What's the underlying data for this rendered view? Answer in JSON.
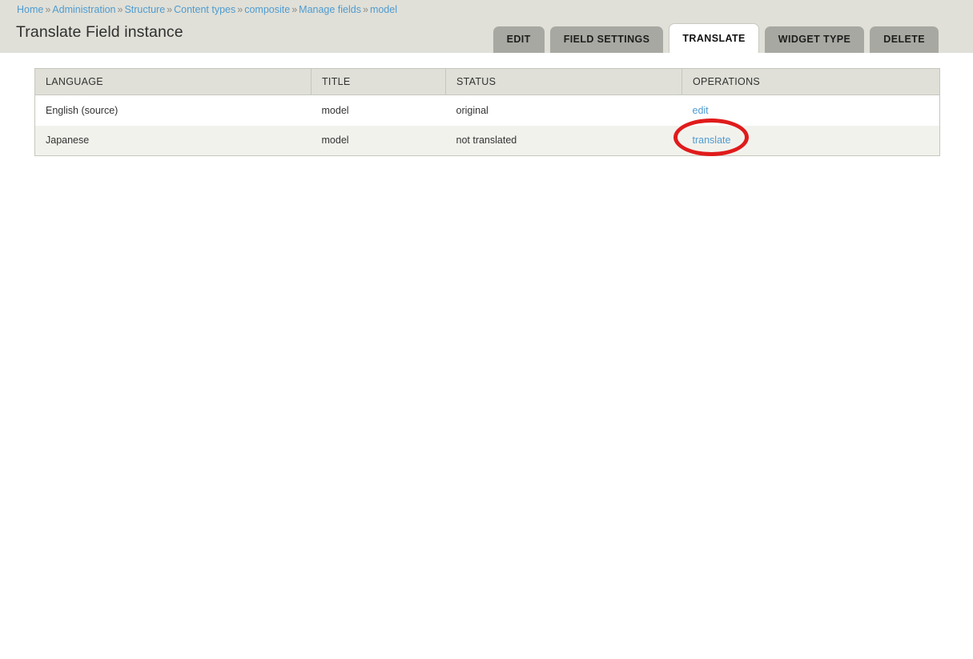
{
  "header": {
    "breadcrumb": {
      "separator": "»",
      "items": [
        {
          "label": "Home"
        },
        {
          "label": "Administration"
        },
        {
          "label": "Structure"
        },
        {
          "label": "Content types"
        },
        {
          "label": "composite"
        },
        {
          "label": "Manage fields"
        },
        {
          "label": "model"
        }
      ]
    },
    "title": "Translate Field instance",
    "background_color": "#e0e0d8",
    "link_color": "#4f9bd0"
  },
  "tabs": [
    {
      "label": "EDIT",
      "active": false
    },
    {
      "label": "FIELD SETTINGS",
      "active": false
    },
    {
      "label": "TRANSLATE",
      "active": true
    },
    {
      "label": "WIDGET TYPE",
      "active": false
    },
    {
      "label": "DELETE",
      "active": false
    }
  ],
  "table": {
    "columns": [
      {
        "key": "language",
        "label": "LANGUAGE"
      },
      {
        "key": "title",
        "label": "TITLE"
      },
      {
        "key": "status",
        "label": "STATUS"
      },
      {
        "key": "operations",
        "label": "OPERATIONS"
      }
    ],
    "rows": [
      {
        "language": "English (source)",
        "title": "model",
        "status": "original",
        "operation_label": "edit"
      },
      {
        "language": "Japanese",
        "title": "model",
        "status": "not translated",
        "operation_label": "translate"
      }
    ],
    "header_background": "#e0e0d9",
    "row_even_background": "#f2f2ed",
    "border_color": "#c6c6be"
  },
  "annotation": {
    "shape": "ellipse",
    "color": "#e01b1b",
    "targets": "translate"
  }
}
